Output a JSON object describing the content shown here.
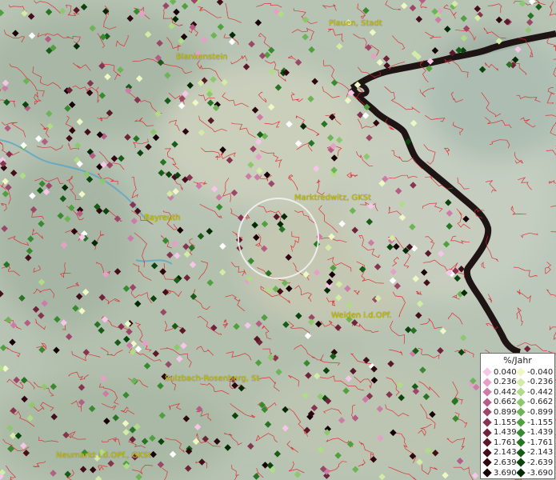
{
  "cities": [
    {
      "id": "plauen",
      "label": "Plauen, Stadt"
    },
    {
      "id": "blankenstein",
      "label": "Blankenstein"
    },
    {
      "id": "bayreuth",
      "label": "Bayreuth"
    },
    {
      "id": "marktredwitz",
      "label": "Marktredwitz, GKSt"
    },
    {
      "id": "weiden",
      "label": "Weiden i.d.OPf."
    },
    {
      "id": "sulzbach",
      "label": "Sulzbach-Rosenberg, St"
    },
    {
      "id": "neumarkt",
      "label": "Neumarkt i.d.OPf., GKSt"
    }
  ],
  "legend": {
    "title": "%/Jahr",
    "positive": [
      {
        "value": "0.040",
        "color": "#f6c6e8"
      },
      {
        "value": "0.236",
        "color": "#e6a0c8"
      },
      {
        "value": "0.442",
        "color": "#cc7ca6"
      },
      {
        "value": "0.662",
        "color": "#b45e86"
      },
      {
        "value": "0.899",
        "color": "#9c4668"
      },
      {
        "value": "1.155",
        "color": "#86344f"
      },
      {
        "value": "1.439",
        "color": "#70243b"
      },
      {
        "value": "1.761",
        "color": "#5a1829"
      },
      {
        "value": "2.143",
        "color": "#440e1b"
      },
      {
        "value": "2.639",
        "color": "#2e0711"
      },
      {
        "value": "3.690",
        "color": "#160207"
      }
    ],
    "negative": [
      {
        "value": "-0.040",
        "color": "#eef8c4"
      },
      {
        "value": "-0.236",
        "color": "#d2eca6"
      },
      {
        "value": "-0.442",
        "color": "#b0dc88"
      },
      {
        "value": "-0.662",
        "color": "#8ec86e"
      },
      {
        "value": "-0.899",
        "color": "#6cb456"
      },
      {
        "value": "-1.155",
        "color": "#50a040"
      },
      {
        "value": "-1.439",
        "color": "#388a30"
      },
      {
        "value": "-1.761",
        "color": "#267424"
      },
      {
        "value": "-2.143",
        "color": "#185c18"
      },
      {
        "value": "-2.639",
        "color": "#0c440e"
      },
      {
        "value": "-3.690",
        "color": "#042a06"
      }
    ]
  }
}
